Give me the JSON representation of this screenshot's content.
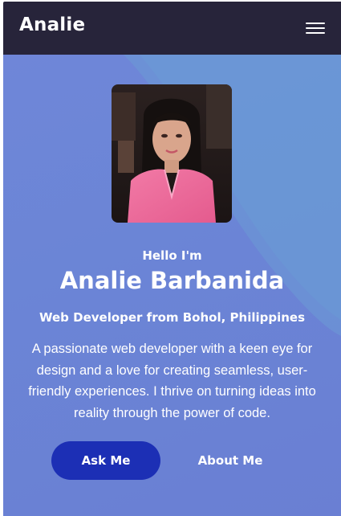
{
  "navbar": {
    "brand": "Analie",
    "menu_icon": "hamburger-menu-icon"
  },
  "hero": {
    "greeting": "Hello I'm",
    "name": "Analie Barbanida",
    "role": "Web Developer from Bohol, Philippines",
    "bio": "A passionate web developer with a keen eye for design and a love for creating seamless, user-friendly experiences. I thrive on turning ideas into reality through the power of code.",
    "primary_button": "Ask Me",
    "secondary_button": "About Me"
  },
  "colors": {
    "navbar_bg": "#27243a",
    "hero_bg": "#6b85d6",
    "primary_button_bg": "#1c2fb5",
    "text": "#ffffff"
  }
}
